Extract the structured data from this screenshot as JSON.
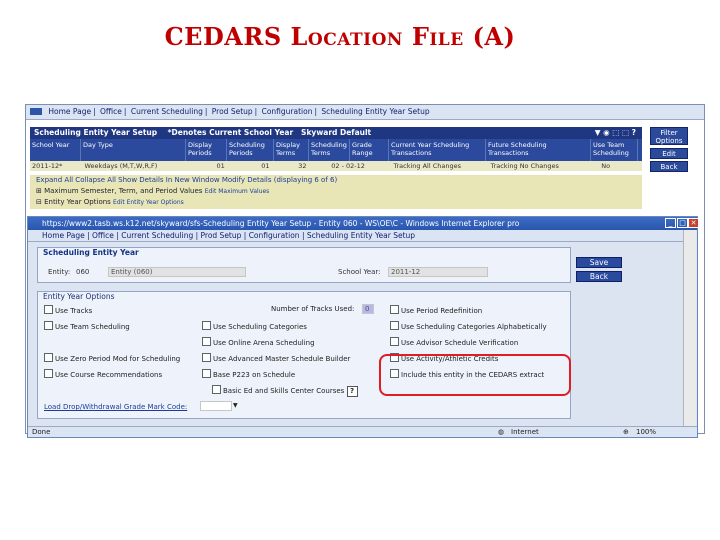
{
  "slide_title": "CEDARS Location File (A)",
  "nav_items": [
    "Home Page",
    "Office",
    "Current Scheduling",
    "Prod Setup",
    "Configuration",
    "Scheduling Entity Year Setup"
  ],
  "back_window": {
    "grid_title": "Scheduling Entity Year Setup",
    "grid_subtitle": "*Denotes Current School Year",
    "grid_default": "Skyward Default",
    "columns": [
      "School Year",
      "Day Type",
      "Display Periods",
      "Scheduling Periods",
      "Display Terms",
      "Scheduling Terms",
      "Grade Range",
      "Current Year Scheduling Transactions",
      "Future Scheduling Transactions",
      "Use Team Scheduling"
    ],
    "row": [
      "2011-12*",
      "Weekdays (M,T,W,R,F)",
      "01",
      "01",
      "32",
      "02 - 02-12",
      "Tracking All Changes",
      "Tracking No Changes",
      "No"
    ],
    "expand_links": "Expand All   Collapse All   Show Details In New Window   Modify Details (displaying 6 of 6)",
    "row2_label": "Maximum Semester, Term, and Period Values",
    "row2_link": "Edit Maximum Values",
    "row3_label": "Entity Year Options",
    "row3_link": "Edit Entity Year Options",
    "side_buttons": [
      "Filter Options",
      "Edit",
      "Back"
    ]
  },
  "popup": {
    "window_title": "https://www2.tasb.ws.k12.net/skyward/sfs-Scheduling Entity Year Setup - Entity 060 - WS\\OE\\C - Windows Internet Explorer pro",
    "panel_title": "Scheduling Entity Year",
    "entity_label": "Entity:",
    "entity_value": "060",
    "entity_name": "Entity (060)",
    "school_year_label": "School Year:",
    "school_year_value": "2011-12",
    "save_label": "Save",
    "back_label": "Back",
    "options_title": "Entity Year Options",
    "tracks_used_label": "Number of Tracks Used:",
    "tracks_used_value": "0",
    "options": [
      "Use Tracks",
      "Use Period Redefinition",
      "Use Team Scheduling",
      "Use Scheduling Categories",
      "Use Scheduling Categories Alphabetically",
      "Use Online Arena Scheduling",
      "Use Advisor Schedule Verification",
      "Use Zero Period Mod for Scheduling",
      "Use Advanced Master Schedule Builder",
      "Use Activity/Athletic Credits",
      "Use Course Recommendations",
      "Base P223 on Schedule",
      "Include this entity in the CEDARS extract",
      "Basic Ed and Skills Center Courses"
    ],
    "grade_mark_label": "Load Drop/Withdrawal Grade Mark Code:",
    "status_done": "Done",
    "status_zone": "Internet",
    "status_zoom": "100%"
  }
}
